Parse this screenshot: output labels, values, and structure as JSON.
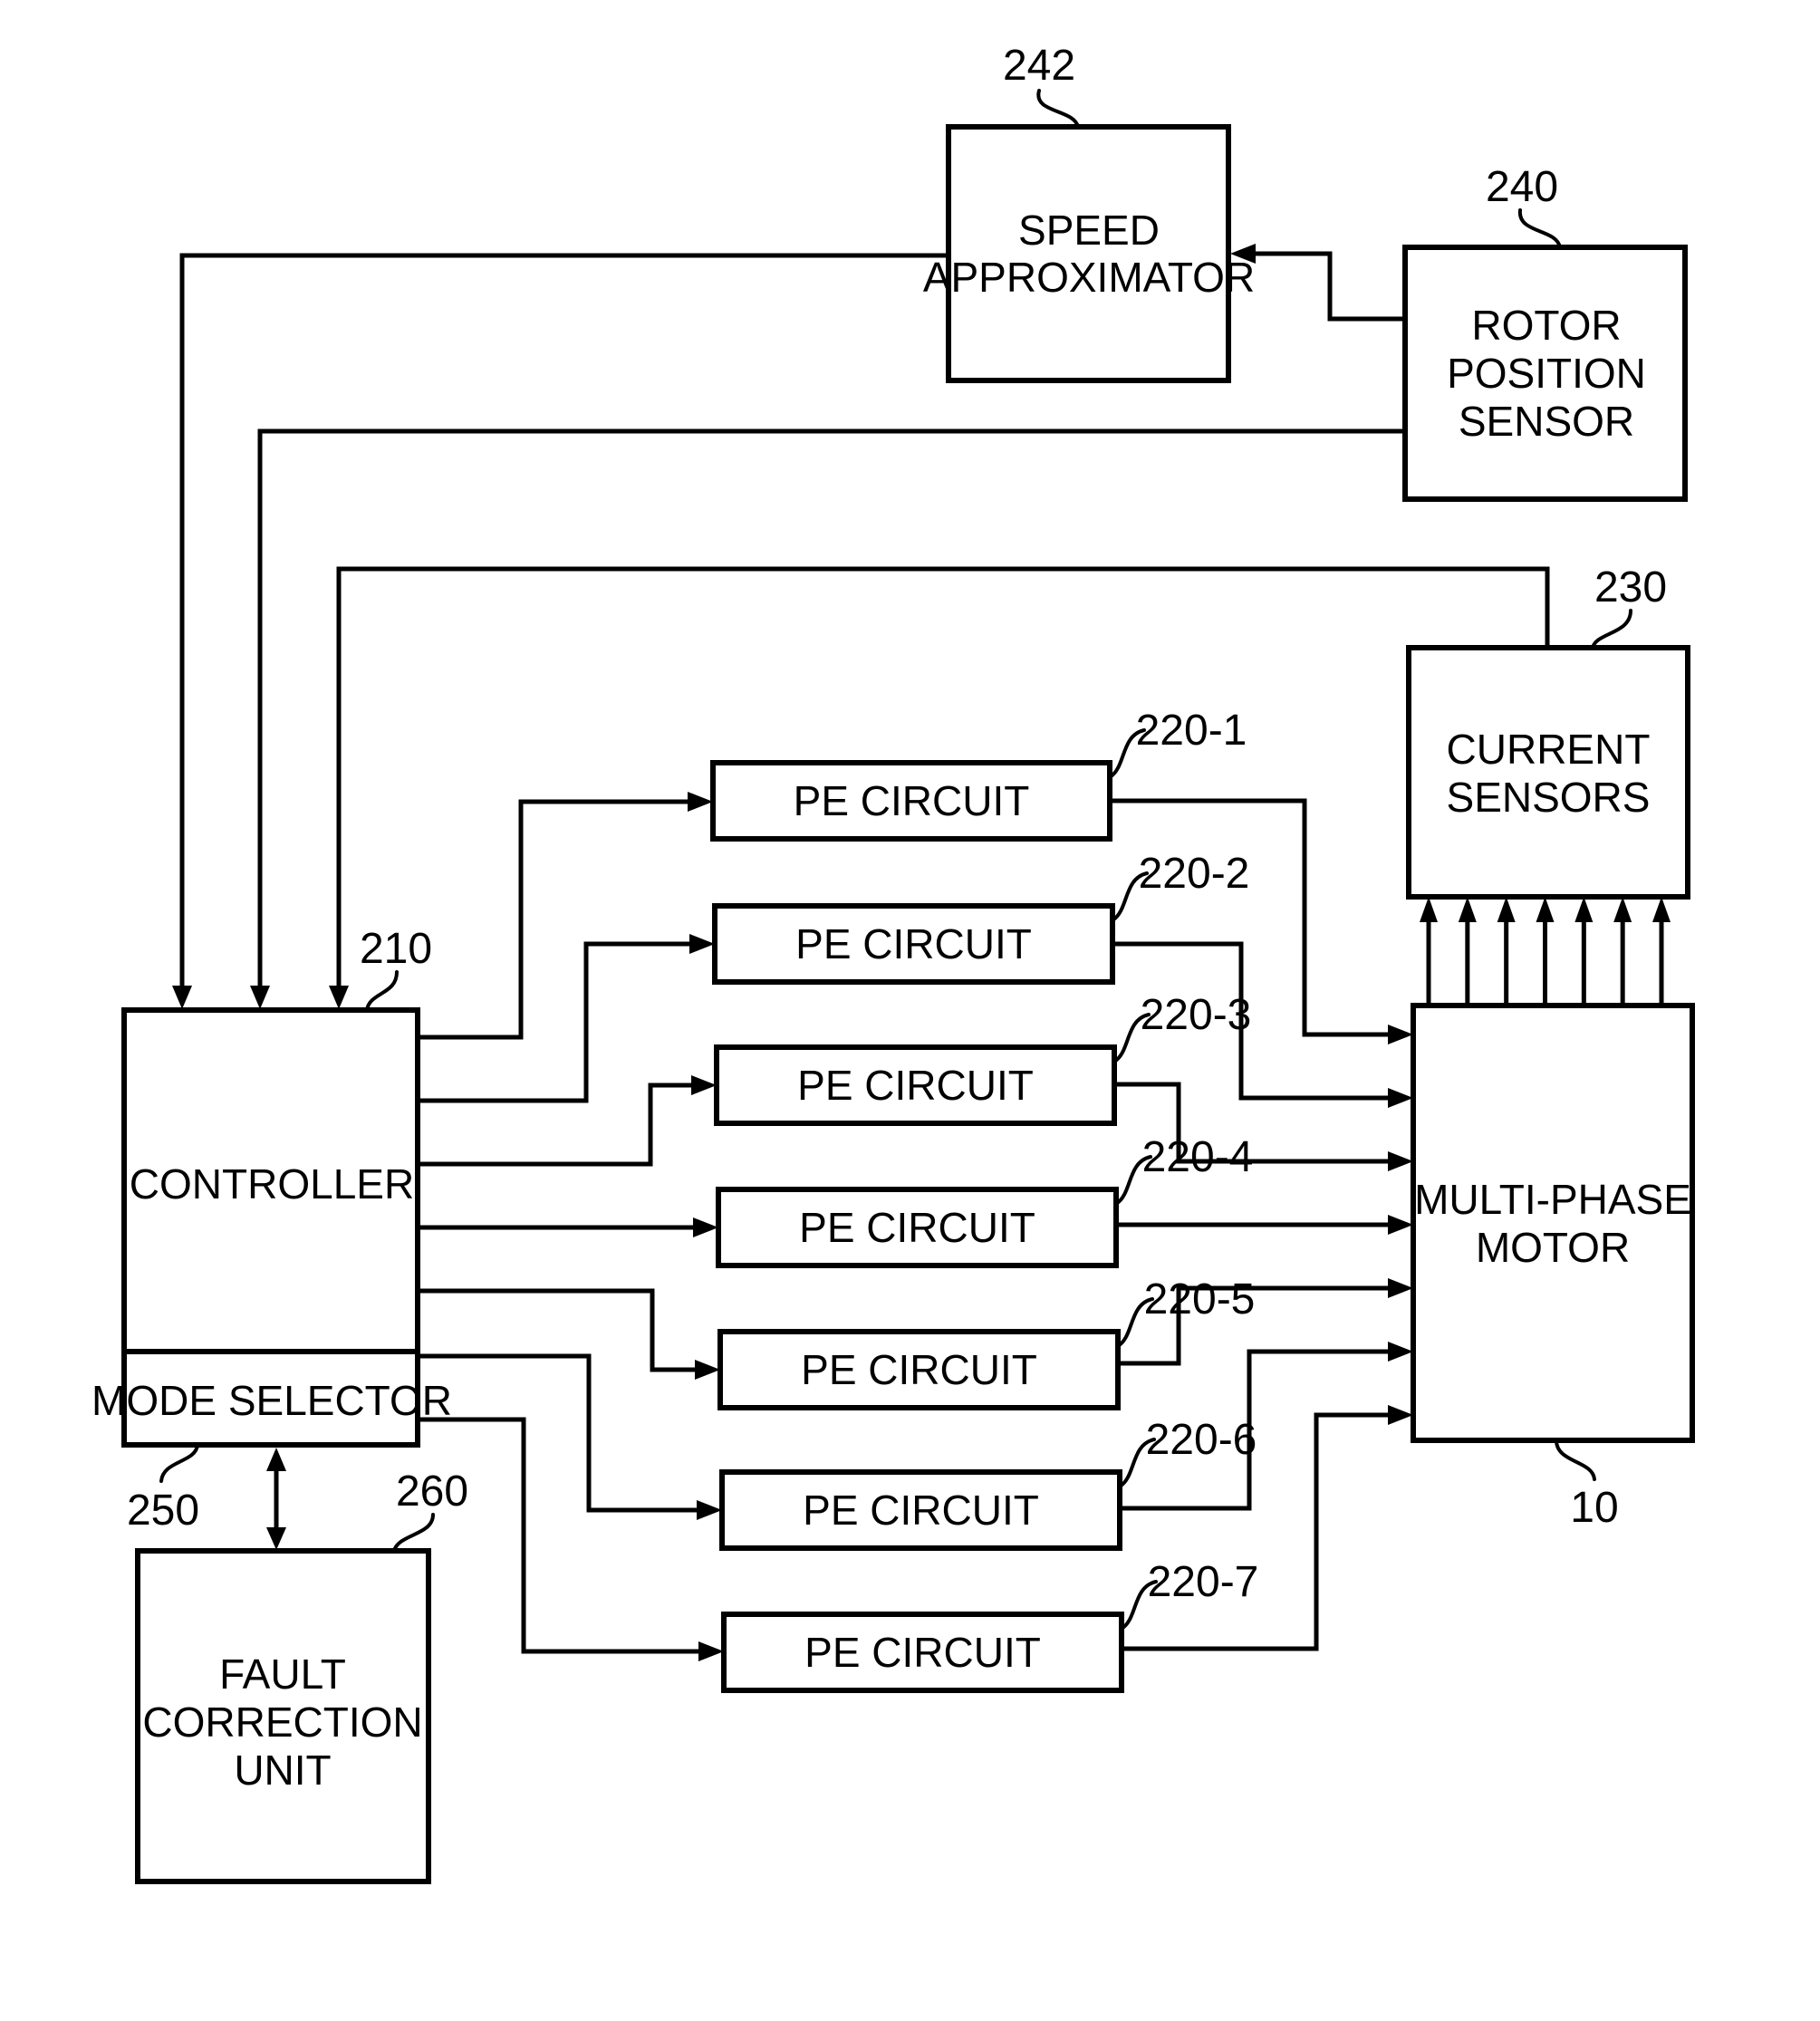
{
  "figure": {
    "blocks": {
      "speed_approximator": {
        "lines": [
          "SPEED",
          "APPROXIMATOR"
        ],
        "ref": "242"
      },
      "rotor_position_sensor": {
        "lines": [
          "ROTOR",
          "POSITION",
          "SENSOR"
        ],
        "ref": "240"
      },
      "current_sensors": {
        "lines": [
          "CURRENT",
          "SENSORS"
        ],
        "ref": "230"
      },
      "controller": {
        "lines": [
          "CONTROLLER"
        ],
        "ref": "210"
      },
      "mode_selector": {
        "lines": [
          "MODE SELECTOR"
        ],
        "ref": "250"
      },
      "fault_correction_unit": {
        "lines": [
          "FAULT",
          "CORRECTION",
          "UNIT"
        ],
        "ref": "260"
      },
      "multi_phase_motor": {
        "lines": [
          "MULTI-PHASE",
          "MOTOR"
        ],
        "ref": "10"
      }
    },
    "pe_circuits": [
      {
        "label": "PE CIRCUIT",
        "ref": "220-1"
      },
      {
        "label": "PE CIRCUIT",
        "ref": "220-2"
      },
      {
        "label": "PE CIRCUIT",
        "ref": "220-3"
      },
      {
        "label": "PE CIRCUIT",
        "ref": "220-4"
      },
      {
        "label": "PE CIRCUIT",
        "ref": "220-5"
      },
      {
        "label": "PE CIRCUIT",
        "ref": "220-6"
      },
      {
        "label": "PE CIRCUIT",
        "ref": "220-7"
      }
    ],
    "current_sensor_inputs": 7,
    "colors": {
      "ink": "#000000",
      "paper": "#ffffff"
    }
  }
}
